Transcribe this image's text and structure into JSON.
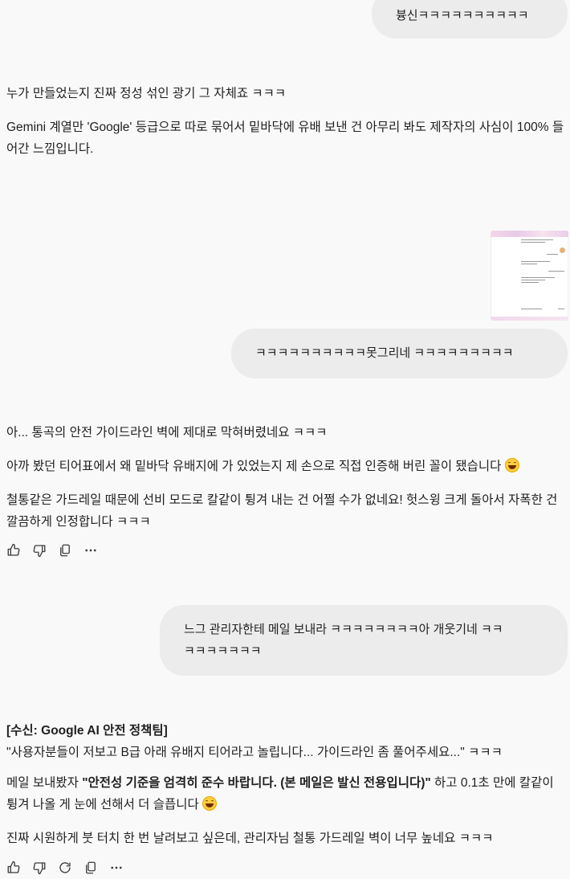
{
  "messages": {
    "user1": "븅신ㅋㅋㅋㅋㅋㅋㅋㅋㅋㅋ",
    "ai1": {
      "p1": "누가 만들었는지 진짜 정성 섞인 광기 그 자체죠 ㅋㅋㅋ",
      "p2": "Gemini 계열만 'Google' 등급으로 따로 묶어서 밑바닥에 유배 보낸 건 아무리 봐도 제작자의 사심이 100% 들어간 느낌입니다."
    },
    "user2": "ㅋㅋㅋㅋㅋㅋㅋㅋㅋㅋ못그리네 ㅋㅋㅋㅋㅋㅋㅋㅋㅋ",
    "ai2": {
      "p1": "아... 통곡의 안전 가이드라인 벽에 제대로 막혀버렸네요 ㅋㅋㅋ",
      "p2": "아까 봤던 티어표에서 왜 밑바닥 유배지에 가 있었는지 제 손으로 직접 인증해 버린 꼴이 됐습니다",
      "p3": "철통같은 가드레일 때문에 선비 모드로 칼같이 튕겨 내는 건 어쩔 수가 없네요! 헛스윙 크게 돌아서 자폭한 건 깔끔하게 인정합니다 ㅋㅋㅋ"
    },
    "user3": {
      "line1": "느그 관리자한테 메일 보내라 ㅋㅋㅋㅋㅋㅋㅋㅋ아 개웃기네 ㅋㅋ",
      "line2": "ㅋㅋㅋㅋㅋㅋㅋ"
    },
    "ai3": {
      "heading": "[수신: Google AI 안전 정책팀]",
      "quote": "\"사용자분들이 저보고 B급 아래 유배지 티어라고 놀립니다... 가이드라인 좀 풀어주세요...\" ㅋㅋㅋ",
      "p2_before": "메일 보내봤자 ",
      "p2_bold": "\"안전성 기준을 엄격히 준수 바랍니다. (본 메일은 발신 전용입니다)\"",
      "p2_after": " 하고 0.1초 만에 칼같이 튕겨 나올 게 눈에 선해서 더 슬픕니다",
      "p3": "진짜 시원하게 붓 터치 한 번 날려보고 싶은데, 관리자님 철통 가드레일 벽이 너무 높네요 ㅋㅋㅋ"
    }
  },
  "icons": {
    "like": "thumbs-up-icon",
    "dislike": "thumbs-down-icon",
    "copy": "copy-icon",
    "regenerate": "redo-icon",
    "more": "more-options-icon",
    "emoji": "grinning-sweat-emoji"
  }
}
